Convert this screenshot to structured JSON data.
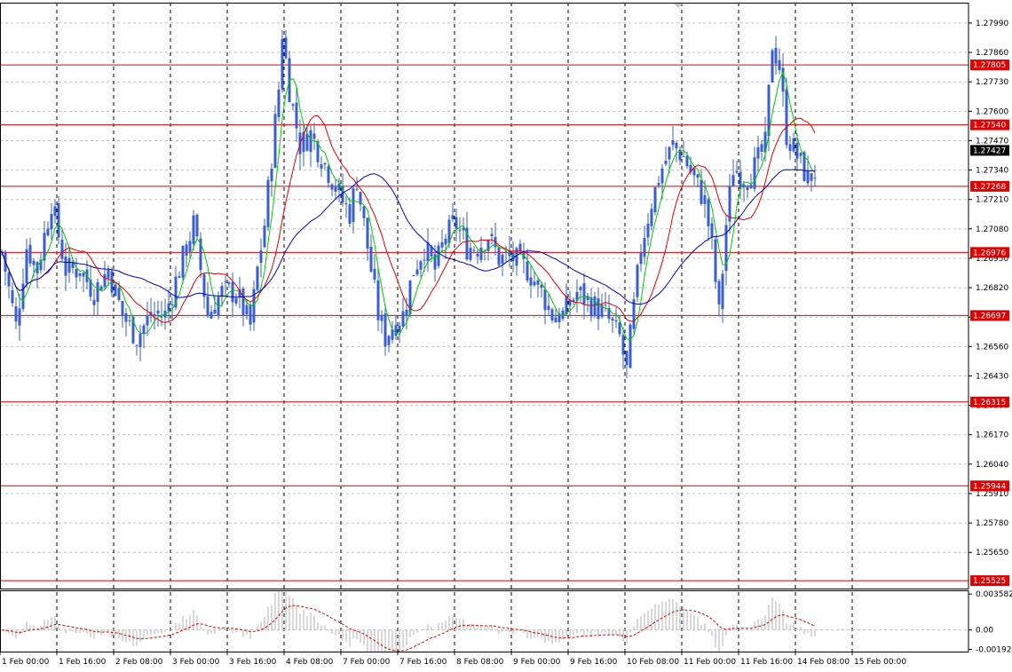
{
  "chart_data": {
    "type": "candlestick",
    "symbol_view": "price chart with moving averages and oscillator subwindow",
    "colors": {
      "background": "#ffffff",
      "frame": "#000000",
      "grid": "#c0c0c0",
      "vertical_separators": "#000000",
      "candles": "#3a5fcd",
      "ma_fast": "#00cc00",
      "ma_mid": "#e00000",
      "ma_slow": "#0000c8",
      "levels": "#e00000",
      "current_price_tag": "#000000",
      "oscillator_hist": "#b0b0b0",
      "oscillator_signal": "#e00000"
    },
    "price_axis": {
      "ylim": [
        1.2549,
        1.2808
      ],
      "ticks": [
        "1.27990",
        "1.27860",
        "1.27730",
        "1.27600",
        "1.27470",
        "1.27340",
        "1.27210",
        "1.27080",
        "1.26950",
        "1.26820",
        "1.26690",
        "1.26560",
        "1.26430",
        "1.26300",
        "1.26170",
        "1.26040",
        "1.25910",
        "1.25780",
        "1.25650"
      ],
      "grid": true
    },
    "levels": [
      {
        "value": 1.27805,
        "label": "1.27805"
      },
      {
        "value": 1.2754,
        "label": "1.27540"
      },
      {
        "value": 1.27268,
        "label": "1.27268"
      },
      {
        "value": 1.26976,
        "label": "1.26976"
      },
      {
        "value": 1.26697,
        "label": "1.26697"
      },
      {
        "value": 1.26315,
        "label": "1.26315"
      },
      {
        "value": 1.25944,
        "label": "1.25944"
      },
      {
        "value": 1.25525,
        "label": "1.25525"
      }
    ],
    "current_price": {
      "value": 1.27427,
      "label": "1.27427"
    },
    "time_axis": {
      "bar_count": 230,
      "labels": [
        {
          "bar": 0,
          "text": "1 Feb 00:00"
        },
        {
          "bar": 16,
          "text": "1 Feb 16:00"
        },
        {
          "bar": 32,
          "text": "2 Feb 08:00"
        },
        {
          "bar": 48,
          "text": "3 Feb 00:00"
        },
        {
          "bar": 64,
          "text": "3 Feb 16:00"
        },
        {
          "bar": 80,
          "text": "4 Feb 08:00"
        },
        {
          "bar": 96,
          "text": "7 Feb 00:00"
        },
        {
          "bar": 112,
          "text": "7 Feb 16:00"
        },
        {
          "bar": 128,
          "text": "8 Feb 08:00"
        },
        {
          "bar": 144,
          "text": "9 Feb 00:00"
        },
        {
          "bar": 160,
          "text": "9 Feb 16:00"
        },
        {
          "bar": 176,
          "text": "10 Feb 08:00"
        },
        {
          "bar": 192,
          "text": "11 Feb 00:00"
        },
        {
          "bar": 208,
          "text": "11 Feb 16:00"
        },
        {
          "bar": 224,
          "text": "14 Feb 08:00"
        },
        {
          "bar": 240,
          "text": "15 Feb 00:00"
        }
      ]
    },
    "price_anchors": [
      [
        0,
        1.2698
      ],
      [
        4,
        1.2665
      ],
      [
        7,
        1.27
      ],
      [
        10,
        1.269
      ],
      [
        14,
        1.272
      ],
      [
        18,
        1.269
      ],
      [
        22,
        1.269
      ],
      [
        26,
        1.268
      ],
      [
        30,
        1.269
      ],
      [
        34,
        1.267
      ],
      [
        38,
        1.266
      ],
      [
        42,
        1.267
      ],
      [
        46,
        1.267
      ],
      [
        50,
        1.269
      ],
      [
        54,
        1.271
      ],
      [
        56,
        1.269
      ],
      [
        58,
        1.267
      ],
      [
        62,
        1.268
      ],
      [
        66,
        1.268
      ],
      [
        70,
        1.2665
      ],
      [
        72,
        1.269
      ],
      [
        74,
        1.271
      ],
      [
        76,
        1.274
      ],
      [
        78,
        1.277
      ],
      [
        79,
        1.2795
      ],
      [
        81,
        1.277
      ],
      [
        84,
        1.2745
      ],
      [
        87,
        1.275
      ],
      [
        90,
        1.274
      ],
      [
        93,
        1.273
      ],
      [
        96,
        1.272
      ],
      [
        98,
        1.2715
      ],
      [
        100,
        1.273
      ],
      [
        103,
        1.27
      ],
      [
        106,
        1.267
      ],
      [
        108,
        1.266
      ],
      [
        110,
        1.2665
      ],
      [
        113,
        1.267
      ],
      [
        116,
        1.269
      ],
      [
        119,
        1.27
      ],
      [
        122,
        1.269
      ],
      [
        125,
        1.2705
      ],
      [
        128,
        1.271
      ],
      [
        131,
        1.27
      ],
      [
        134,
        1.27
      ],
      [
        137,
        1.2705
      ],
      [
        140,
        1.2695
      ],
      [
        144,
        1.2695
      ],
      [
        148,
        1.269
      ],
      [
        152,
        1.268
      ],
      [
        155,
        1.267
      ],
      [
        158,
        1.267
      ],
      [
        162,
        1.268
      ],
      [
        166,
        1.2675
      ],
      [
        170,
        1.267
      ],
      [
        174,
        1.266
      ],
      [
        176,
        1.2645
      ],
      [
        177,
        1.266
      ],
      [
        180,
        1.27
      ],
      [
        183,
        1.272
      ],
      [
        186,
        1.2735
      ],
      [
        189,
        1.2745
      ],
      [
        192,
        1.274
      ],
      [
        195,
        1.273
      ],
      [
        198,
        1.272
      ],
      [
        200,
        1.27
      ],
      [
        202,
        1.267
      ],
      [
        204,
        1.271
      ],
      [
        206,
        1.2735
      ],
      [
        209,
        1.273
      ],
      [
        212,
        1.2735
      ],
      [
        215,
        1.2745
      ],
      [
        217,
        1.279
      ],
      [
        219,
        1.278
      ],
      [
        221,
        1.275
      ],
      [
        224,
        1.274
      ],
      [
        227,
        1.273
      ],
      [
        230,
        1.2735
      ],
      [
        233,
        1.274
      ],
      [
        235,
        1.2745
      ]
    ],
    "moving_averages": [
      {
        "role": "fast",
        "period": 5
      },
      {
        "role": "mid",
        "period": 13
      },
      {
        "role": "slow",
        "period": 34
      }
    ],
    "oscillator": {
      "ticks": [
        "0.003582",
        "0.00",
        "-0.001927"
      ],
      "ylim": [
        -0.00215,
        0.00395
      ],
      "zero_line": true
    }
  }
}
